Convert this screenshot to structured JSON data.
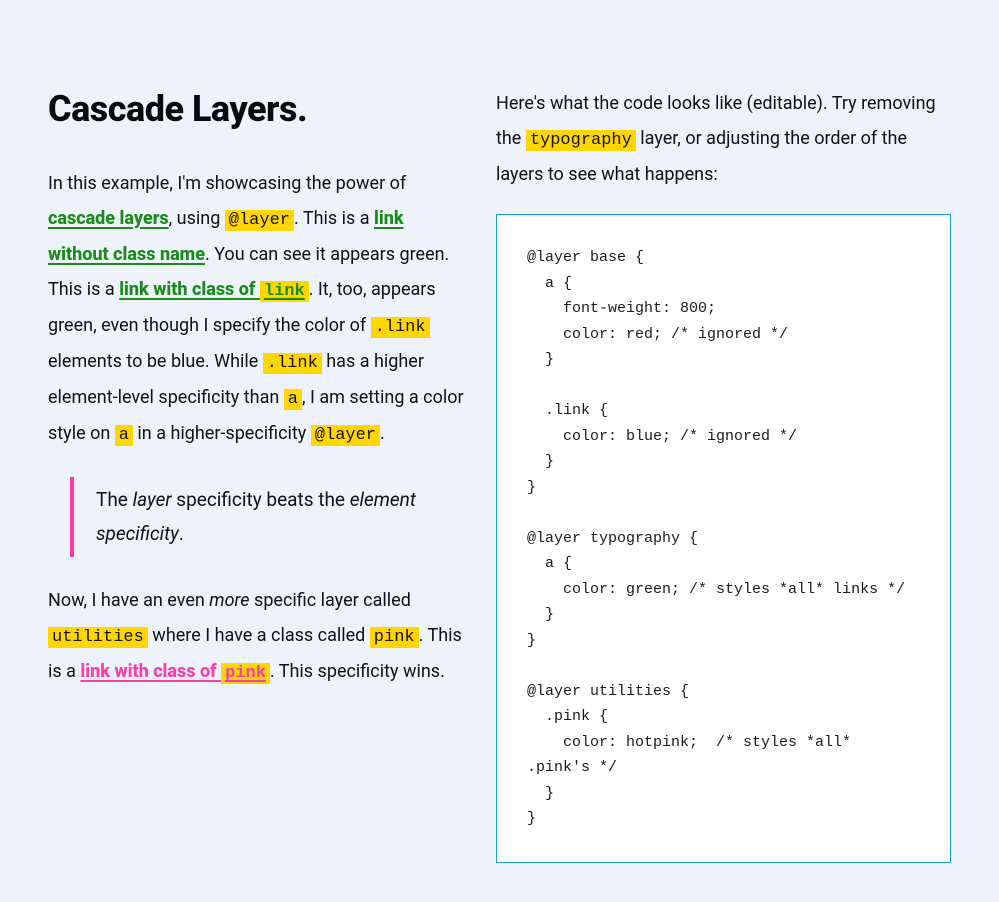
{
  "title": "Cascade Layers.",
  "left": {
    "p1": {
      "t1": "In this example, I'm showcasing the power of ",
      "link_cascade": "cascade layers",
      "t2": ", using ",
      "code_layer1": "@layer",
      "t3": ". This is a ",
      "link_noclass": "link without class name",
      "t4": ". You can see it appears green. This is a ",
      "link_withclass_pre": "link with class of ",
      "link_withclass_code": "link",
      "t5": ". It, too, appears green, even though I specify the color of ",
      "code_dotlink1": ".link",
      "t6": " elements to be blue. While ",
      "code_dotlink2": ".link",
      "t7": " has a higher element-level specificity than ",
      "code_a1": "a",
      "t8": ", I am setting a color style on ",
      "code_a2": "a",
      "t9": " in a higher-specificity ",
      "code_layer2": "@layer",
      "t10": "."
    },
    "blockquote": {
      "t1": "The ",
      "em1": "layer",
      "t2": " specificity beats the ",
      "em2": "element specificity",
      "t3": "."
    },
    "p2": {
      "t1": "Now, I have an even ",
      "em_more": "more",
      "t2": " specific layer called ",
      "code_utilities": "utilities",
      "t3": " where I have a class called ",
      "code_pink": "pink",
      "t4": ". This is a ",
      "link_pink_pre": "link with class of ",
      "link_pink_code": "pink",
      "t5": ". This specificity wins."
    }
  },
  "right": {
    "intro": {
      "t1": "Here's what the code looks like (editable). Try removing the ",
      "code_typography": "typography",
      "t2": " layer, or adjusting the order of the layers to see what happens:"
    },
    "code": "@layer base {\n  a {\n    font-weight: 800;\n    color: red; /* ignored */\n  }\n\n  .link {\n    color: blue; /* ignored */\n  }\n}\n\n@layer typography {\n  a {\n    color: green; /* styles *all* links */\n  }\n}\n\n@layer utilities {\n  .pink {\n    color: hotpink;  /* styles *all* .pink's */\n  }\n}"
  }
}
